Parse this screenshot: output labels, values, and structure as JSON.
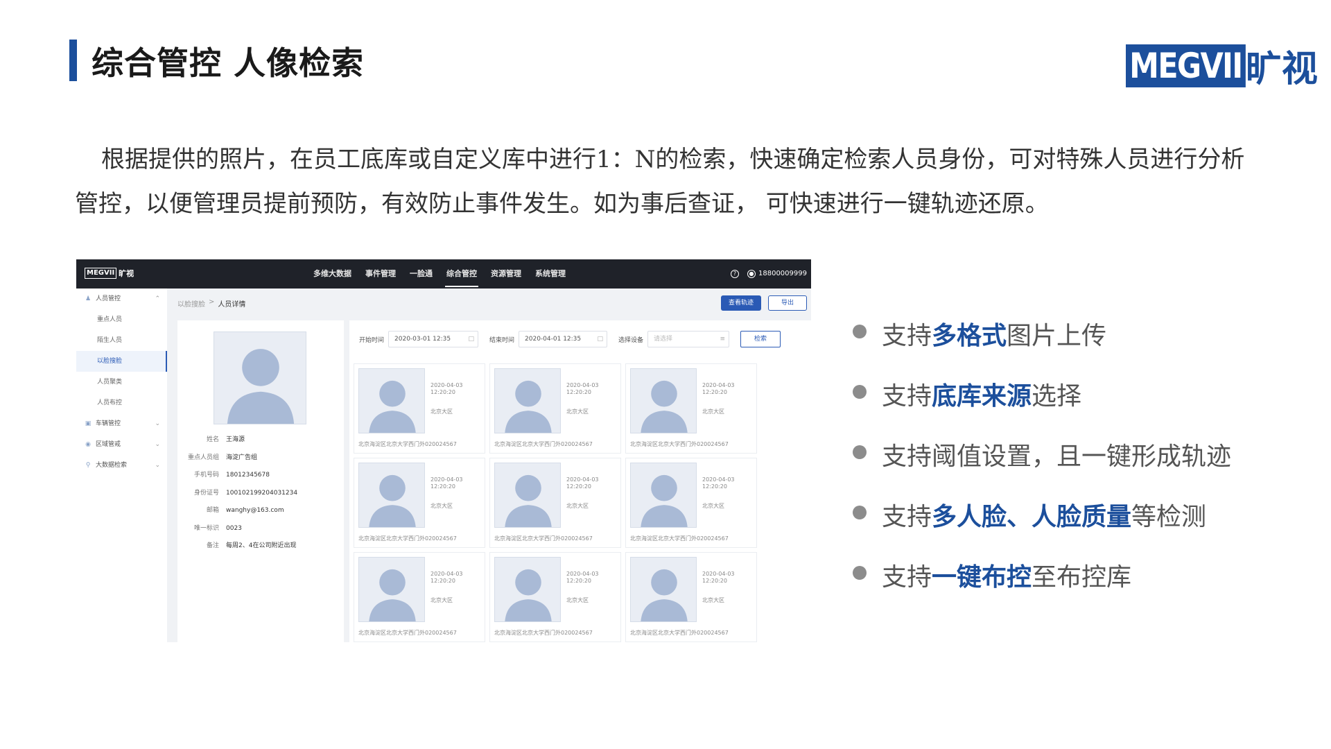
{
  "slide": {
    "title": "综合管控 人像检索",
    "logo": {
      "brand": "MEGVII",
      "cn": "旷视"
    },
    "description": "根据提供的照片，在员工底库或自定义库中进行1：N的检索，快速确定检索人员身份，可对特殊人员进行分析管控，以便管理员提前预防，有效防止事件发生。如为事后查证， 可快速进行一键轨迹还原。",
    "accent_color": "#1c4f9c"
  },
  "app": {
    "nav": {
      "logo_brand": "MEGVII",
      "logo_cn": "旷视",
      "items": [
        "多维大数据",
        "事件管理",
        "一脸通",
        "综合管控",
        "资源管理",
        "系统管理"
      ],
      "active": "综合管控",
      "help_icon": "question-icon",
      "user_icon": "user-icon",
      "user": "18800009999"
    },
    "sidebar": [
      {
        "label": "人员管控",
        "icon": "people-icon",
        "level": "top",
        "expanded": true
      },
      {
        "label": "重点人员",
        "level": "sub"
      },
      {
        "label": "陌生人员",
        "level": "sub"
      },
      {
        "label": "以脸搜脸",
        "level": "sub",
        "active": true
      },
      {
        "label": "人员聚类",
        "level": "sub"
      },
      {
        "label": "人员布控",
        "level": "sub"
      },
      {
        "label": "车辆管控",
        "icon": "car-icon",
        "level": "top",
        "expanded": false
      },
      {
        "label": "区域管戒",
        "icon": "area-icon",
        "level": "top",
        "expanded": false
      },
      {
        "label": "大数据检索",
        "icon": "search-icon",
        "level": "top",
        "expanded": false
      }
    ],
    "breadcrumb": {
      "parent": "以脸搜脸",
      "sep": ">",
      "current": "人员详情"
    },
    "buttons": {
      "track": "查看轨迹",
      "export": "导出",
      "search": "检索"
    },
    "person": {
      "fields": [
        {
          "label": "姓名",
          "value": "王海源"
        },
        {
          "label": "重点人员组",
          "value": "海淀广告组"
        },
        {
          "label": "手机号码",
          "value": "18012345678"
        },
        {
          "label": "身份证号",
          "value": "100102199204031234"
        },
        {
          "label": "邮箱",
          "value": "wanghy@163.com"
        },
        {
          "label": "唯一标识",
          "value": "0023"
        },
        {
          "label": "备注",
          "value": "每周2、4在公司附近出现"
        }
      ]
    },
    "filters": {
      "start_label": "开始时间",
      "start_value": "2020-03-01 12:35",
      "end_label": "结束时间",
      "end_value": "2020-04-01 12:35",
      "device_label": "选择设备",
      "device_placeholder": "请选择"
    },
    "results": [
      {
        "date": "2020-04-03",
        "time": "12:20:20",
        "place": "北京大区",
        "address": "北京海淀区北京大学西门外020024567"
      },
      {
        "date": "2020-04-03",
        "time": "12:20:20",
        "place": "北京大区",
        "address": "北京海淀区北京大学西门外020024567"
      },
      {
        "date": "2020-04-03",
        "time": "12:20:20",
        "place": "北京大区",
        "address": "北京海淀区北京大学西门外020024567"
      },
      {
        "date": "2020-04-03",
        "time": "12:20:20",
        "place": "北京大区",
        "address": "北京海淀区北京大学西门外020024567"
      },
      {
        "date": "2020-04-03",
        "time": "12:20:20",
        "place": "北京大区",
        "address": "北京海淀区北京大学西门外020024567"
      },
      {
        "date": "2020-04-03",
        "time": "12:20:20",
        "place": "北京大区",
        "address": "北京海淀区北京大学西门外020024567"
      },
      {
        "date": "2020-04-03",
        "time": "12:20:20",
        "place": "北京大区",
        "address": "北京海淀区北京大学西门外020024567"
      },
      {
        "date": "2020-04-03",
        "time": "12:20:20",
        "place": "北京大区",
        "address": "北京海淀区北京大学西门外020024567"
      },
      {
        "date": "2020-04-03",
        "time": "12:20:20",
        "place": "北京大区",
        "address": "北京海淀区北京大学西门外020024567"
      }
    ]
  },
  "features": [
    {
      "parts": [
        {
          "t": "支持",
          "hl": false
        },
        {
          "t": "多格式",
          "hl": true
        },
        {
          "t": "图片上传",
          "hl": false
        }
      ]
    },
    {
      "parts": [
        {
          "t": "支持",
          "hl": false
        },
        {
          "t": "底库来源",
          "hl": true
        },
        {
          "t": "选择",
          "hl": false
        }
      ]
    },
    {
      "parts": [
        {
          "t": "支持阈值设置，且一键形成轨迹",
          "hl": false
        }
      ]
    },
    {
      "parts": [
        {
          "t": "支持",
          "hl": false
        },
        {
          "t": "多人脸、人脸质量",
          "hl": true
        },
        {
          "t": "等检测",
          "hl": false
        }
      ]
    },
    {
      "parts": [
        {
          "t": "支持",
          "hl": false
        },
        {
          "t": "一键布控",
          "hl": true
        },
        {
          "t": "至布控库",
          "hl": false
        }
      ]
    }
  ]
}
